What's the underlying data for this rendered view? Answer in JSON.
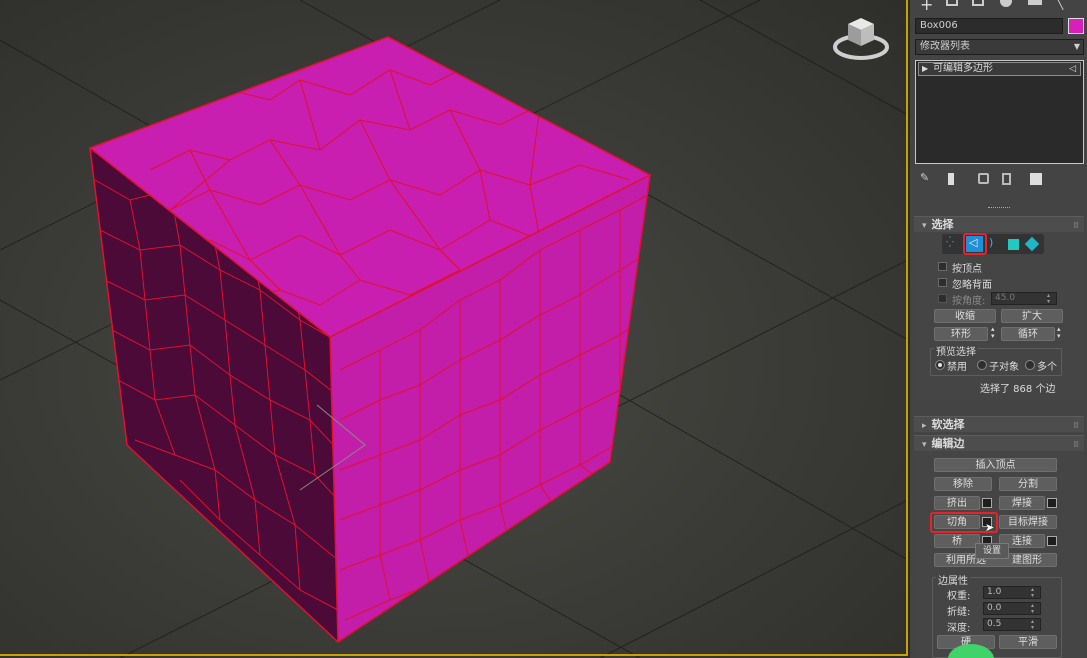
{
  "object": {
    "name": "Box006",
    "color": "#d81fb8"
  },
  "modifier_list": {
    "label": "修改器列表"
  },
  "stack": {
    "item": "可编辑多边形"
  },
  "rollouts": {
    "select": {
      "title": "选择",
      "by_vertex": "按顶点",
      "ignore_backfacing": "忽略背面",
      "by_angle": "按角度:",
      "angle_value": "45.0",
      "shrink": "收缩",
      "grow": "扩大",
      "ring": "环形",
      "loop": "循环",
      "preview_title": "预览选择",
      "preview_off": "禁用",
      "preview_sub": "子对象",
      "preview_multi": "多个",
      "status": "选择了 868 个边"
    },
    "soft": {
      "title": "软选择"
    },
    "edit_edges": {
      "title": "编辑边",
      "insert_vertex": "插入顶点",
      "remove": "移除",
      "split": "分割",
      "extrude": "挤出",
      "weld": "焊接",
      "chamfer": "切角",
      "target_weld": "目标焊接",
      "bridge": "桥",
      "connect": "连接",
      "create_shape_left": "利用所选",
      "create_shape_right": "建图形",
      "tooltip": "设置",
      "edge_props": "边属性",
      "weight_label": "权重:",
      "weight_value": "1.0",
      "crease_label": "折缝:",
      "crease_value": "0.0",
      "depth_label": "深度:",
      "depth_value": "0.5",
      "hard": "硬",
      "smooth": "平滑"
    }
  },
  "colors": {
    "accent_blue": "#1f8fd6",
    "highlight_red": "#e8212b",
    "cube_face": "#c71fae",
    "cube_edge": "#e0102e",
    "frame_yellow": "#c9a100"
  }
}
